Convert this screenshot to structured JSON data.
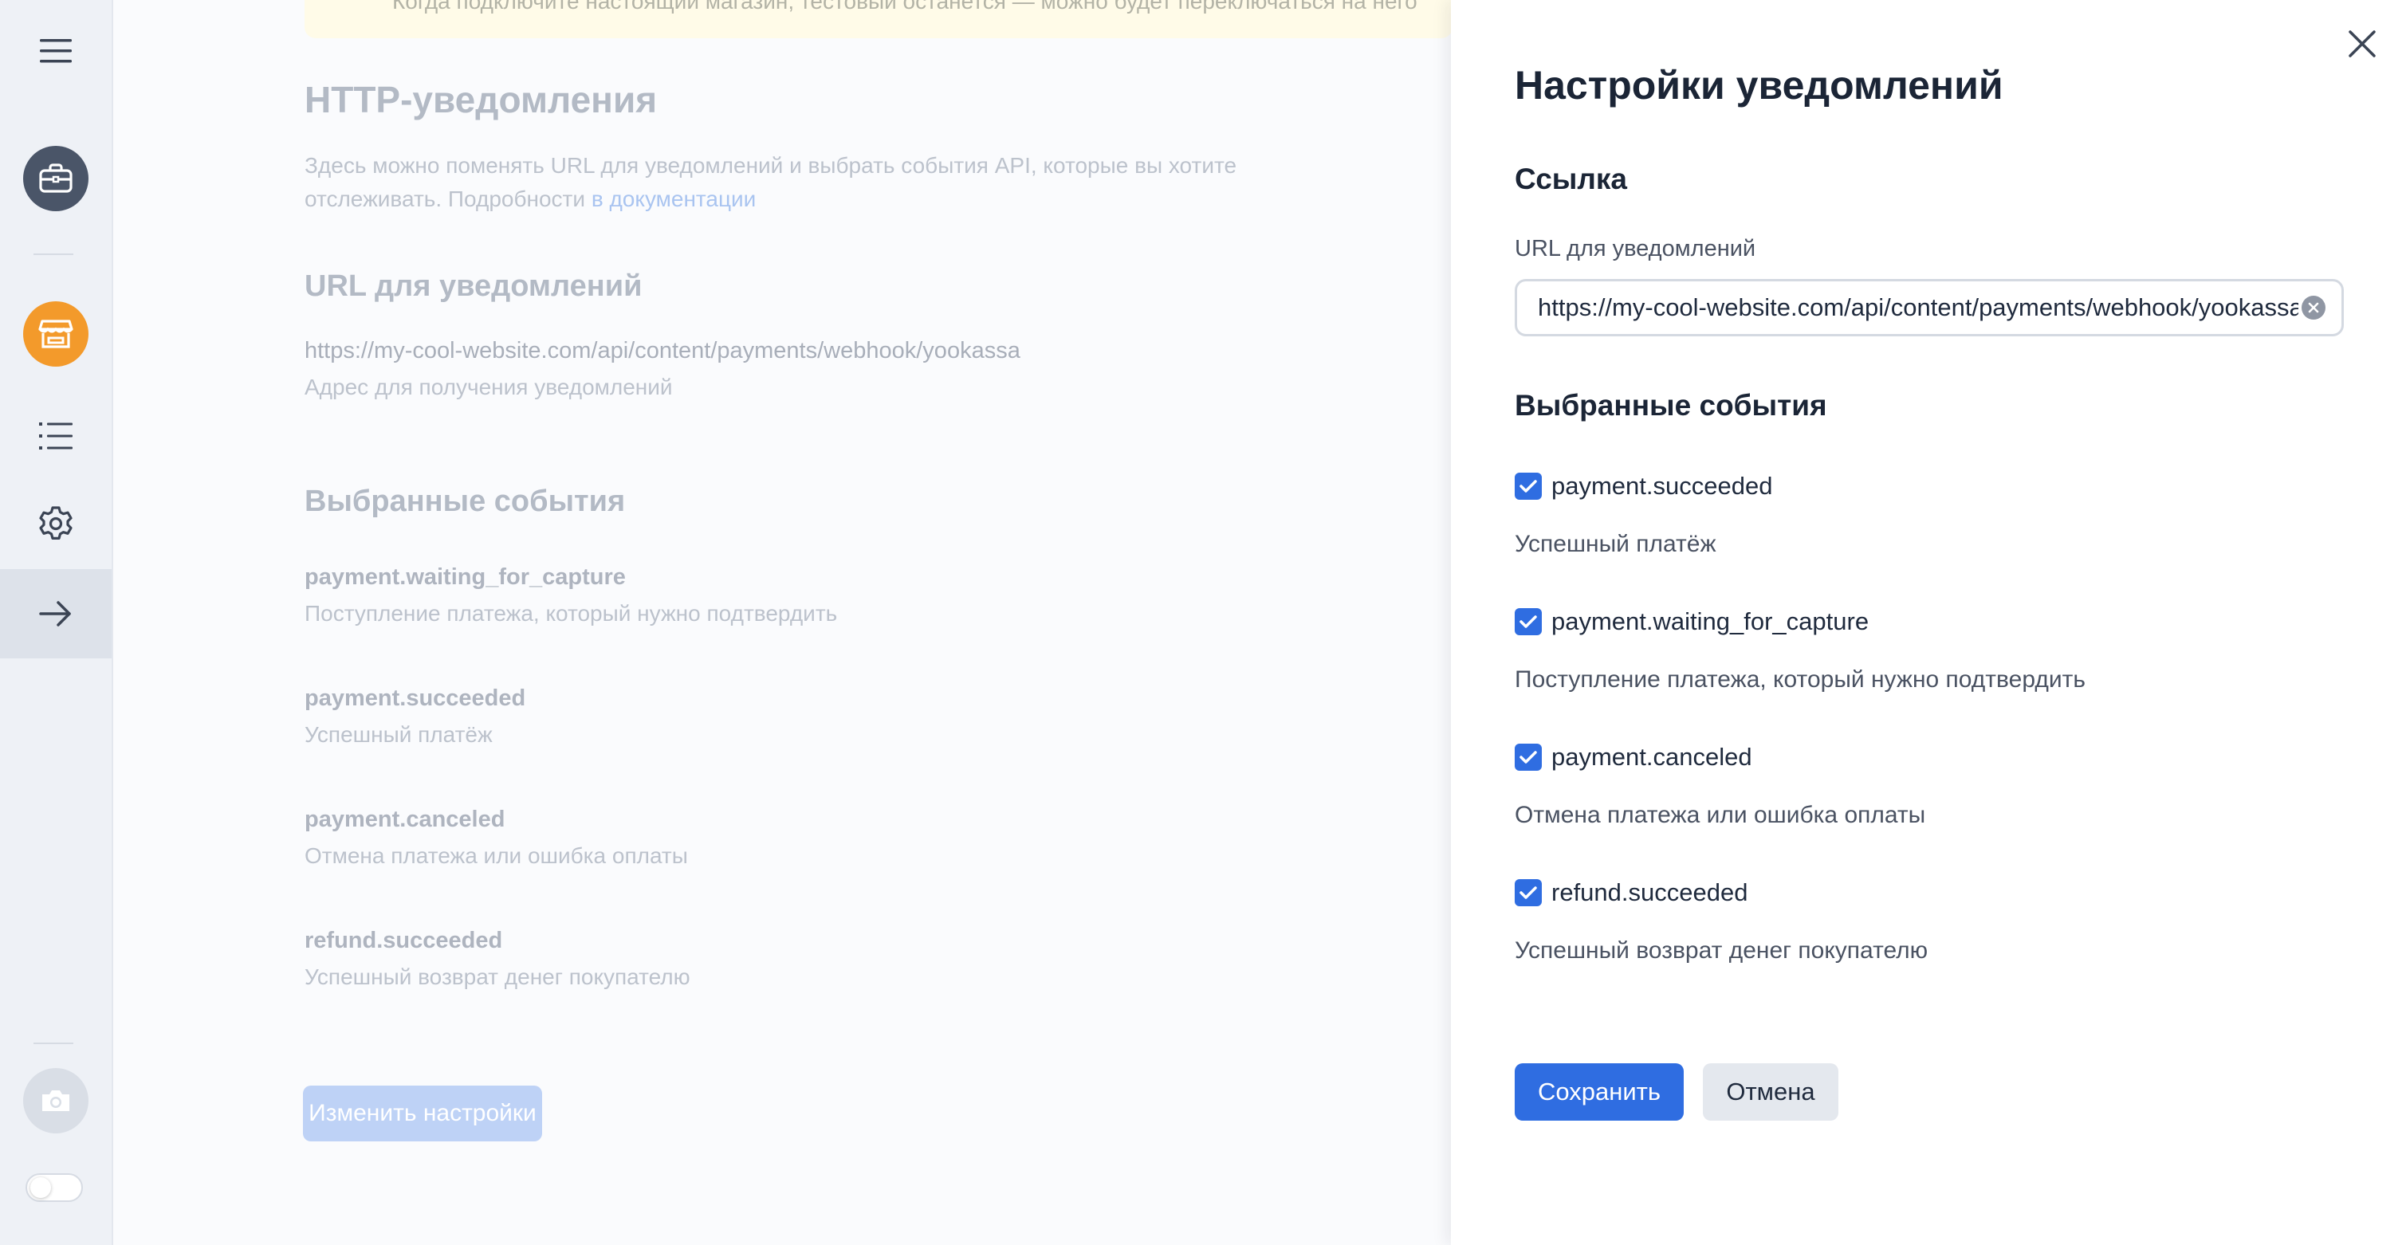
{
  "sidebar": {
    "items": [
      {
        "icon": "menu-icon"
      },
      {
        "icon": "briefcase-icon"
      },
      {
        "icon": "store-icon",
        "color": "#f39a2b"
      },
      {
        "icon": "list-icon"
      },
      {
        "icon": "gear-icon"
      },
      {
        "icon": "arrow-right-icon",
        "active": true
      },
      {
        "icon": "camera-icon"
      }
    ],
    "toggle_on": false
  },
  "background": {
    "banner_text": "Когда подключите настоящий магазин, тестовый останется — можно будет переключаться на него",
    "title": "HTTP-уведомления",
    "description_line1": "Здесь можно поменять URL для уведомлений и выбрать события API, которые вы хотите",
    "description_line2": "отслеживать. Подробности",
    "doc_link": "в документации",
    "url_title": "URL для уведомлений",
    "url_value": "https://my-cool-website.com/api/content/payments/webhook/yookassa",
    "url_hint": "Адрес для получения уведомлений",
    "events_title": "Выбранные события",
    "events": [
      {
        "name": "payment.waiting_for_capture",
        "desc": "Поступление платежа, который нужно подтвердить"
      },
      {
        "name": "payment.succeeded",
        "desc": "Успешный платёж"
      },
      {
        "name": "payment.canceled",
        "desc": "Отмена платежа или ошибка оплаты"
      },
      {
        "name": "refund.succeeded",
        "desc": "Успешный возврат денег покупателю"
      }
    ],
    "edit_button": "Изменить настройки"
  },
  "drawer": {
    "title": "Настройки уведомлений",
    "link_section": "Ссылка",
    "url_label": "URL для уведомлений",
    "url_value": "https://my-cool-website.com/api/content/payments/webhook/yookassa",
    "events_section": "Выбранные события",
    "events": [
      {
        "name": "payment.succeeded",
        "desc": "Успешный платёж",
        "checked": true
      },
      {
        "name": "payment.waiting_for_capture",
        "desc": "Поступление платежа, который нужно подтвердить",
        "checked": true
      },
      {
        "name": "payment.canceled",
        "desc": "Отмена платежа или ошибка оплаты",
        "checked": true
      },
      {
        "name": "refund.succeeded",
        "desc": "Успешный возврат денег покупателю",
        "checked": true
      }
    ],
    "save_label": "Сохранить",
    "cancel_label": "Отмена"
  },
  "colors": {
    "accent": "#2f6de1",
    "store": "#f39a2b",
    "briefcase": "#4a5568"
  }
}
